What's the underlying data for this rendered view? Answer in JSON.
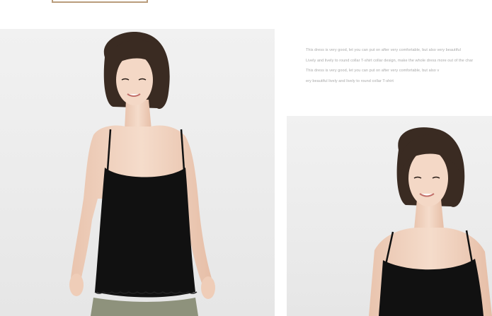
{
  "description": {
    "lines": [
      "This dress is very good, let you can put on after very comfortable, but also very beautiful",
      "Lively and lively to round collar T-shirt collar design, make the whole dress more out of the char",
      "This dress is very good, let you can put on after very comfortable, but also v",
      "ery beautiful lively and lively to round collar T-shirt"
    ]
  },
  "photos": {
    "main": {
      "subject": "model in black camisole"
    },
    "secondary": {
      "subject": "model in black camisole"
    }
  },
  "colors": {
    "frame": "#b99c7b",
    "text": "#a9a9a9",
    "camisole": "#111111",
    "hair": "#3a2b22",
    "skin": "#f1d2bf",
    "pants": "#8e927c",
    "background": "#ececec"
  }
}
